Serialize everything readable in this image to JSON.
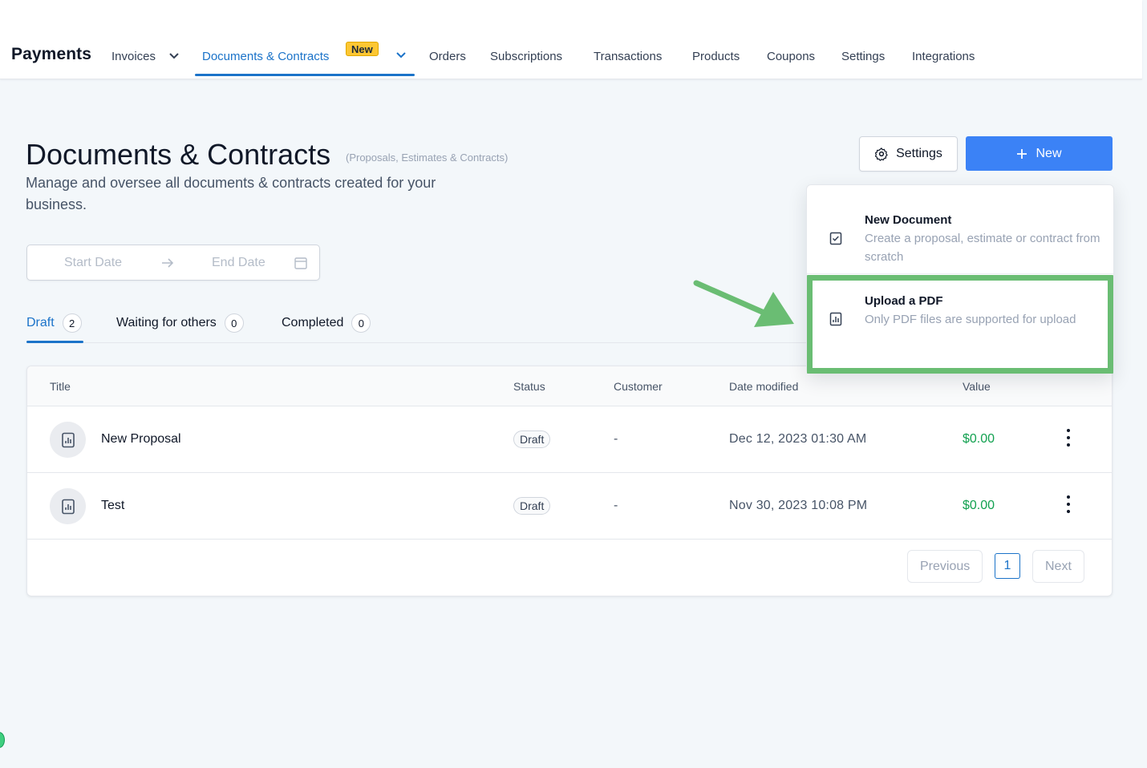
{
  "app": {
    "title": "Payments"
  },
  "nav": {
    "items": [
      {
        "label": "Invoices"
      },
      {
        "label": "Documents & Contracts",
        "badge": "New"
      },
      {
        "label": "Orders"
      },
      {
        "label": "Subscriptions"
      },
      {
        "label": "Transactions"
      },
      {
        "label": "Products"
      },
      {
        "label": "Coupons"
      },
      {
        "label": "Settings"
      },
      {
        "label": "Integrations"
      }
    ]
  },
  "page": {
    "title": "Documents & Contracts",
    "subtitle": "(Proposals, Estimates & Contracts)",
    "description": "Manage and oversee all documents & contracts created for your business."
  },
  "actions": {
    "settings_label": "Settings",
    "new_label": "New"
  },
  "date_range": {
    "start_placeholder": "Start Date",
    "end_placeholder": "End Date"
  },
  "tabs": [
    {
      "label": "Draft",
      "count": "2"
    },
    {
      "label": "Waiting for others",
      "count": "0"
    },
    {
      "label": "Completed",
      "count": "0"
    }
  ],
  "table": {
    "columns": [
      "Title",
      "Status",
      "Customer",
      "Date modified",
      "Value"
    ],
    "rows": [
      {
        "title": "New Proposal",
        "status": "Draft",
        "customer": "-",
        "date": "Dec 12, 2023 01:30 AM",
        "value": "$0.00"
      },
      {
        "title": "Test",
        "status": "Draft",
        "customer": "-",
        "date": "Nov 30, 2023 10:08 PM",
        "value": "$0.00"
      }
    ]
  },
  "pagination": {
    "previous": "Previous",
    "page": "1",
    "next": "Next"
  },
  "dropdown": {
    "items": [
      {
        "title": "New Document",
        "description": "Create a proposal, estimate or contract from scratch",
        "icon": "document-check-icon"
      },
      {
        "title": "Upload a PDF",
        "description": "Only PDF files are supported for upload",
        "icon": "document-chart-icon"
      }
    ]
  },
  "colors": {
    "accent": "#1b73c9",
    "primary_button": "#3b82f6",
    "value_green": "#12a150",
    "highlight": "#6abd73",
    "badge_new": "#fdc733"
  }
}
